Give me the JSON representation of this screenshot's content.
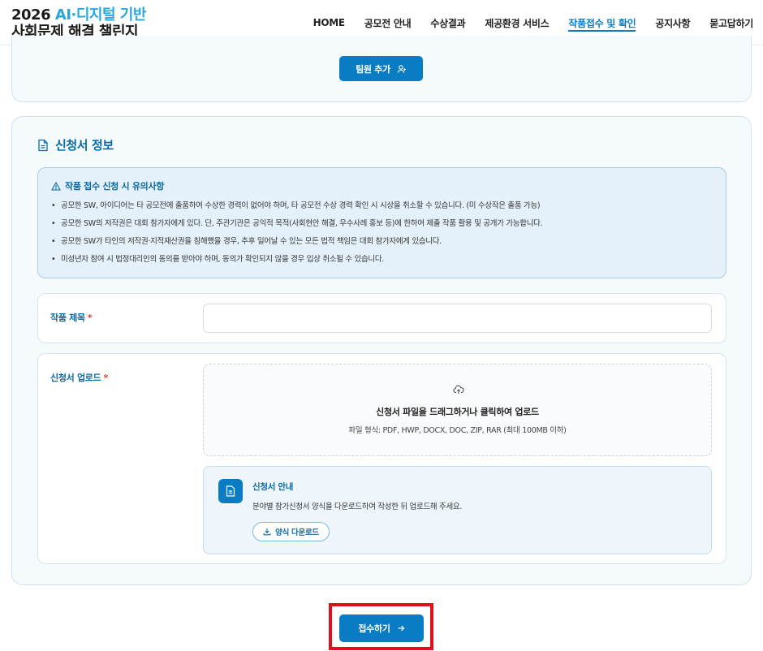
{
  "header": {
    "logo_year": "2026",
    "logo_accent": "AI·디지털 기반",
    "logo_line2": "사회문제 해결 챌린지",
    "nav": [
      {
        "label": "HOME",
        "active": false
      },
      {
        "label": "공모전 안내",
        "active": false
      },
      {
        "label": "수상결과",
        "active": false
      },
      {
        "label": "제공환경 서비스",
        "active": false
      },
      {
        "label": "작품접수 및 확인",
        "active": true
      },
      {
        "label": "공지사항",
        "active": false
      },
      {
        "label": "묻고답하기",
        "active": false
      }
    ]
  },
  "team": {
    "add_button": "팀원 추가",
    "add_icon": "user-add-icon"
  },
  "application": {
    "section_title": "신청서 정보",
    "section_icon": "document-icon",
    "notice": {
      "title": "작품 접수 신청 시 유의사항",
      "icon": "warning-icon",
      "items": [
        "공모한 SW, 아이디어는 타 공모전에 출품하여 수상한 경력이 없어야 하며, 타 공모전 수상 경력 확인 시 시상을 취소할 수 있습니다. (미 수상작은 출품 가능)",
        "공모한 SW의 저작권은 대회 참가자에게 있다. 단, 주관기관은 공익적 목적(사회현안 해결, 우수사례 홍보 등)에 한하여 제출 작품 활용 및 공개가 가능합니다.",
        "공모한 SW가 타인의 저작권·지적재산권을 침해했을 경우, 추후 일어날 수 있는 모든 법적 책임은 대회 참가자에게 있습니다.",
        "미성년자 참여 시 법정대리인의 동의를 받아야 하며, 동의가 확인되지 않을 경우 입상 취소될 수 있습니다."
      ]
    },
    "title_field": {
      "label": "작품 제목",
      "required_mark": "*",
      "value": "",
      "placeholder": ""
    },
    "upload_field": {
      "label": "신청서 업로드",
      "required_mark": "*",
      "dropzone_icon": "cloud-upload-icon",
      "dropzone_main": "신청서 파일을 드래그하거나 클릭하여 업로드",
      "dropzone_sub": "파일 형식: PDF, HWP, DOCX, DOC, ZIP, RAR (최대 100MB 이하)"
    },
    "guide": {
      "icon": "document-icon",
      "title": "신청서 안내",
      "description": "분야별 참가신청서 양식을 다운로드하여 작성한 뒤 업로드해 주세요.",
      "download_button": "양식 다운로드",
      "download_icon": "download-icon"
    }
  },
  "submit": {
    "label": "접수하기",
    "icon": "arrow-right-icon"
  },
  "colors": {
    "primary": "#0a7cc4",
    "accent": "#2aa7e0",
    "required": "#e03a3a",
    "highlight": "#e0101a"
  }
}
